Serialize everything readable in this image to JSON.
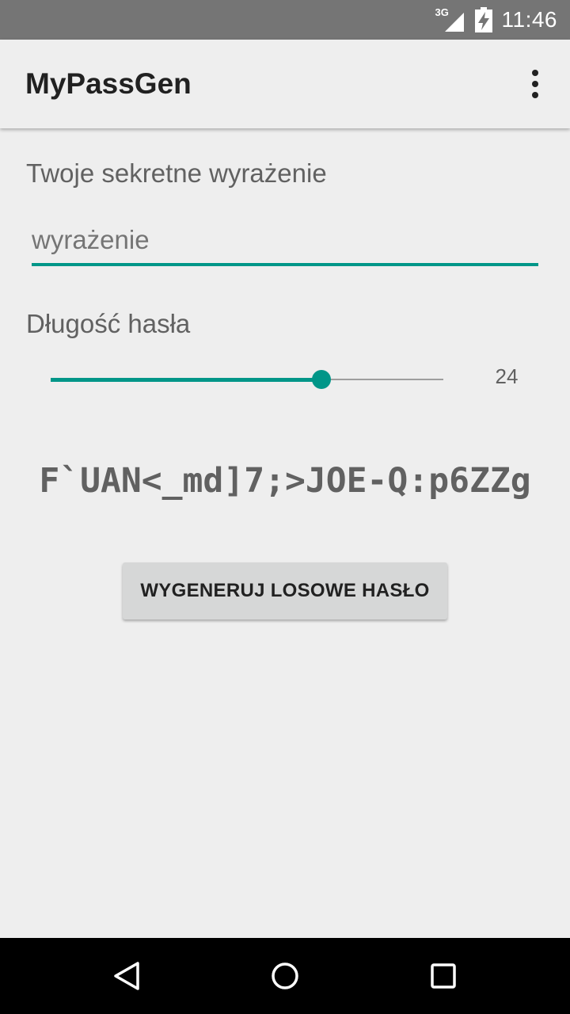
{
  "status_bar": {
    "network_type": "3G",
    "time": "11:46",
    "icons": [
      "signal-icon",
      "battery-charging-icon"
    ]
  },
  "app_bar": {
    "title": "MyPassGen",
    "menu_icon": "more-vert-icon"
  },
  "form": {
    "phrase_label": "Twoje sekretne wyrażenie",
    "phrase_placeholder": "wyrażenie",
    "phrase_value": "",
    "length_label": "Długość hasła",
    "length_value": "24",
    "length_fraction": 0.69
  },
  "output": {
    "password": "F`UAN<_md]7;>JOE-Q:p6ZZg"
  },
  "actions": {
    "generate_label": "WYGENERUJ LOSOWE HASŁO"
  },
  "nav_bar": {
    "icons": [
      "back-icon",
      "home-icon",
      "recents-icon"
    ]
  },
  "colors": {
    "accent": "#009688",
    "status_bar": "#757575",
    "background": "#eeeeee",
    "button": "#d6d7d7"
  }
}
